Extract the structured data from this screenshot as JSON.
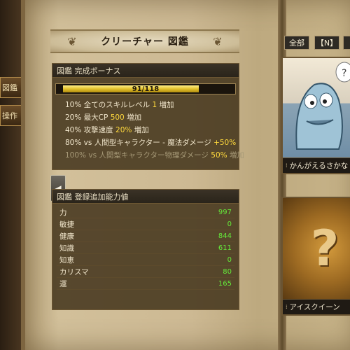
{
  "side_tabs": [
    "図鑑",
    "操作"
  ],
  "title": "クリーチャー 図鑑",
  "bonus_panel": {
    "header": "図鑑 完成ボーナス",
    "progress_text": "91/118",
    "progress_value": 91,
    "progress_max": 118,
    "items": [
      {
        "pre": "10% 全てのスキルレベル ",
        "hl": "1",
        "post": " 増加"
      },
      {
        "pre": "20% 最大CP ",
        "hl": "500",
        "post": " 増加"
      },
      {
        "pre": "40% 攻撃速度 ",
        "hl": "20%",
        "post": " 増加"
      },
      {
        "pre": "80% vs 人間型キャラクター - 魔法ダメージ ",
        "hl": "+50%",
        "post": ""
      },
      {
        "pre": "100% vs 人間型キャラクター物理ダメージ ",
        "hl": "50%",
        "post": " 増加"
      }
    ]
  },
  "stats_panel": {
    "header": "図鑑 登録追加能力値",
    "rows": [
      {
        "label": "力",
        "value": "997"
      },
      {
        "label": "敏捷",
        "value": "0"
      },
      {
        "label": "健康",
        "value": "844"
      },
      {
        "label": "知識",
        "value": "611"
      },
      {
        "label": "知恵",
        "value": "0"
      },
      {
        "label": "カリスマ",
        "value": "80"
      },
      {
        "label": "運",
        "value": "165"
      }
    ]
  },
  "nav_arrow": "◀",
  "filters": [
    "全部",
    "【N】",
    ""
  ],
  "cards": [
    {
      "caption": "かんがえるさかな"
    },
    {
      "caption": "アイスクイーン"
    }
  ],
  "card_unknown_symbol": "?"
}
